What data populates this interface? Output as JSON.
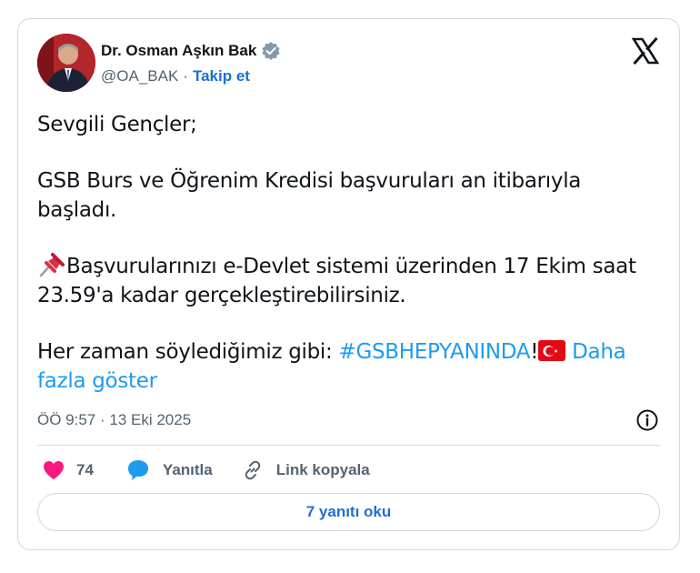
{
  "author": {
    "display_name": "Dr. Osman Aşkın Bak",
    "handle": "@OA_BAK",
    "separator": "·",
    "follow_label": "Takip et",
    "verified_color": "#829aab"
  },
  "tweet": {
    "line1": "Sevgili Gençler;",
    "line2": "GSB Burs ve Öğrenim Kredisi başvuruları an itibarıyla başladı.",
    "line3": "Başvurularınızı e-Devlet sistemi üzerinden 17 Ekim saat 23.59'a kadar gerçekleştirebilirsiniz.",
    "line4_text": "Her zaman söylediğimiz gibi: ",
    "hashtag": "#GSBHEPYANINDA",
    "exclamation": "!",
    "show_more": "Daha fazla göster",
    "timestamp": "ÖÖ 9:57 · 13 Eki 2025"
  },
  "actions": {
    "like_count": "74",
    "reply_label": "Yanıtla",
    "copy_link_label": "Link kopyala",
    "read_replies_label": "7 yanıtı oku"
  },
  "colors": {
    "link": "#1d9bf0",
    "heart": "#f91880",
    "reply_bubble": "#1d9bf0",
    "flag_red": "#e30a17"
  },
  "icons": [
    "verified-badge-icon",
    "x-logo-icon",
    "pushpin-icon",
    "turkish-flag-icon",
    "info-icon",
    "heart-icon",
    "reply-bubble-icon",
    "link-icon"
  ]
}
